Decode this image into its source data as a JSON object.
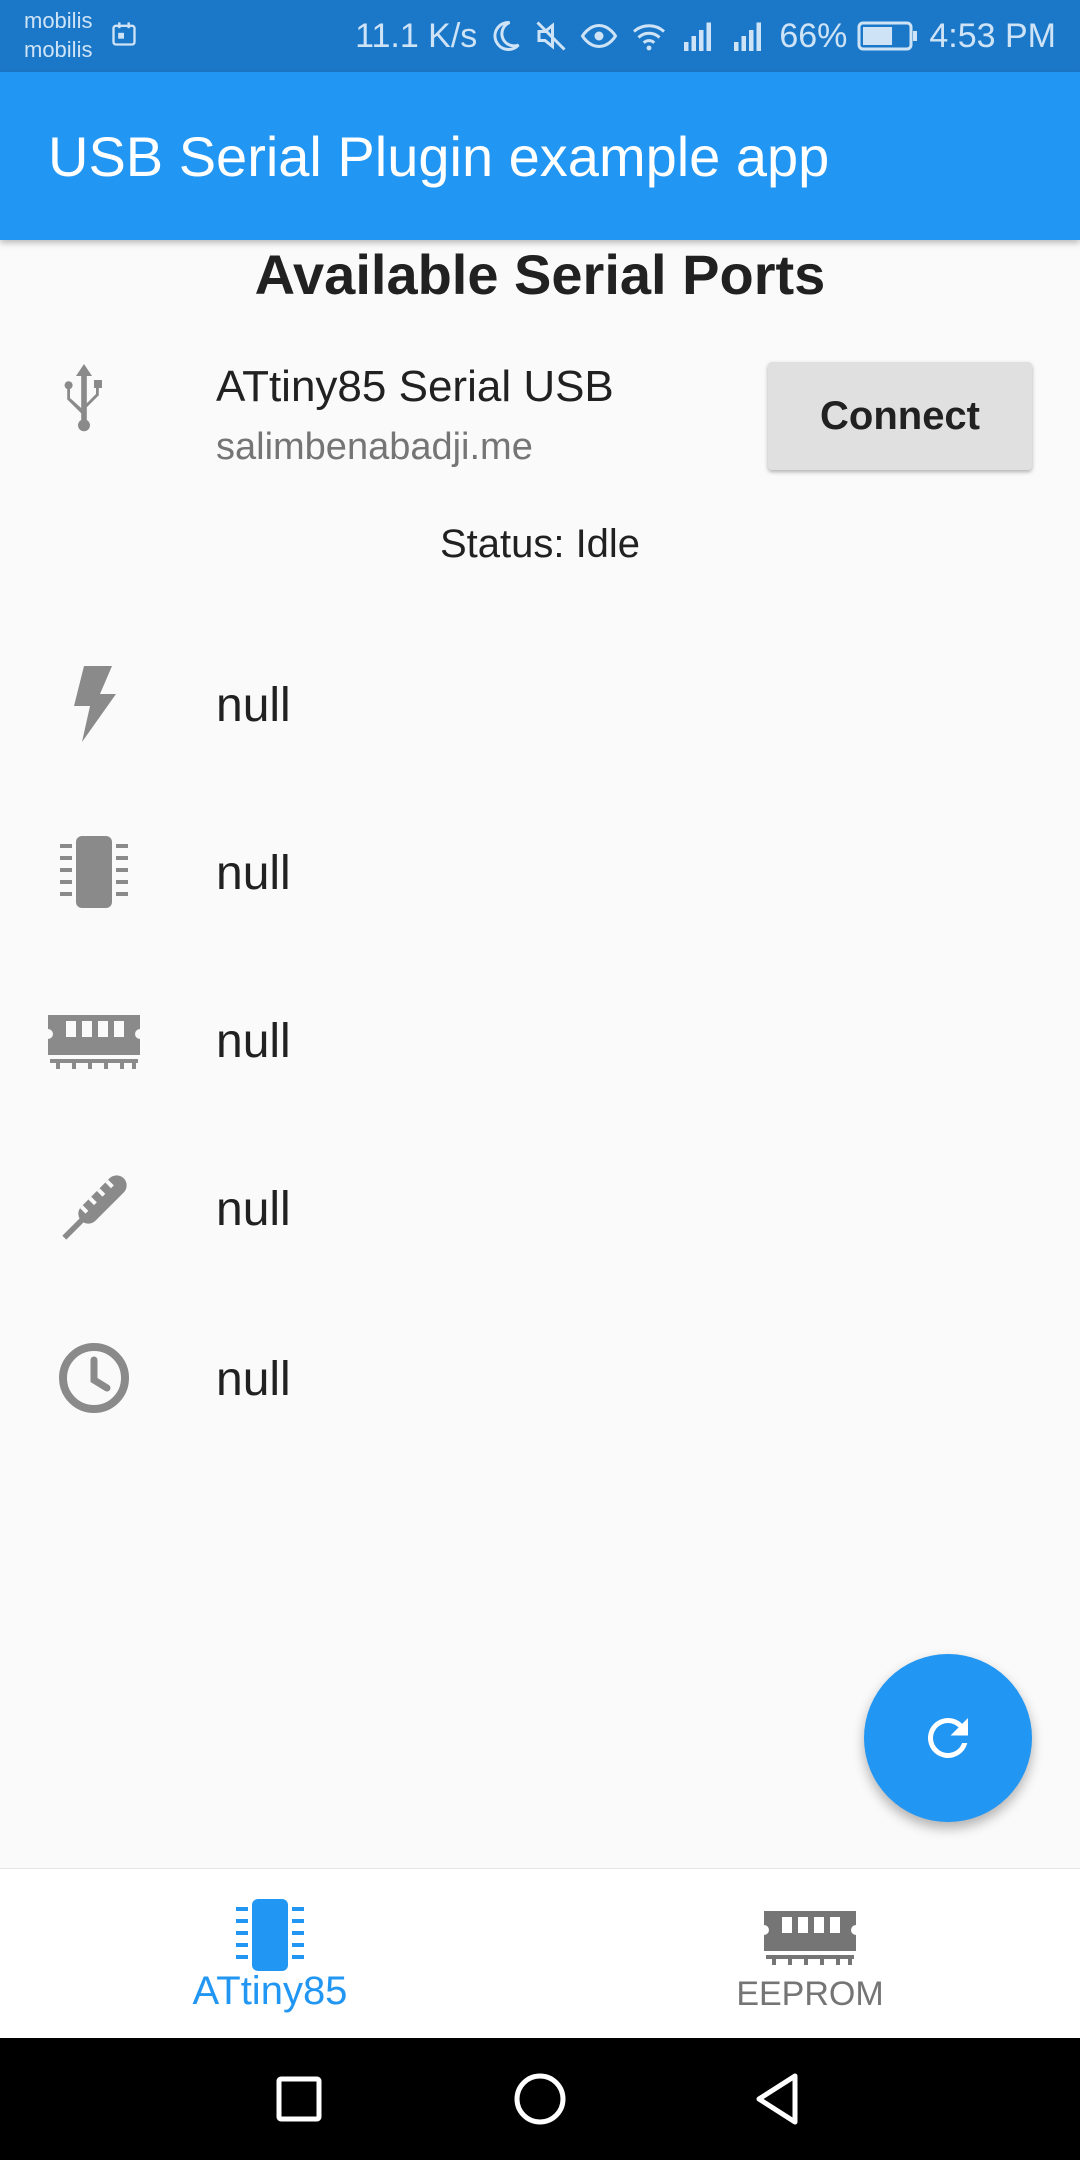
{
  "status_bar": {
    "carrier_line1": "mobilis",
    "carrier_line2": "mobilis",
    "net_speed": "11.1 K/s",
    "battery_percent": "66%",
    "time": "4:53 PM",
    "battery_level": 0.66
  },
  "app_bar": {
    "title": "USB Serial Plugin example app"
  },
  "section": {
    "title": "Available Serial Ports"
  },
  "ports": [
    {
      "name": "ATtiny85 Serial USB",
      "manufacturer": "salimbenabadji.me",
      "connect_label": "Connect",
      "icon": "usb-icon"
    }
  ],
  "status": {
    "text": "Status: Idle"
  },
  "info_rows": [
    {
      "icon": "flash-icon",
      "value": "null"
    },
    {
      "icon": "chip-icon",
      "value": "null"
    },
    {
      "icon": "memory-icon",
      "value": "null"
    },
    {
      "icon": "thermometer-icon",
      "value": "null"
    },
    {
      "icon": "clock-icon",
      "value": "null"
    }
  ],
  "fab": {
    "icon": "refresh-icon"
  },
  "bottom_nav": {
    "items": [
      {
        "label": "ATtiny85",
        "icon": "chip-icon",
        "active": true
      },
      {
        "label": "EEPROM",
        "icon": "memory-icon",
        "active": false
      }
    ]
  },
  "system_nav": {
    "icons": [
      "recents-icon",
      "home-icon",
      "back-icon"
    ]
  },
  "colors": {
    "primary": "#2196f3",
    "status_bar": "#1b78c9",
    "icon_grey": "#8a8a8a",
    "button_grey": "#e0e0e0"
  }
}
